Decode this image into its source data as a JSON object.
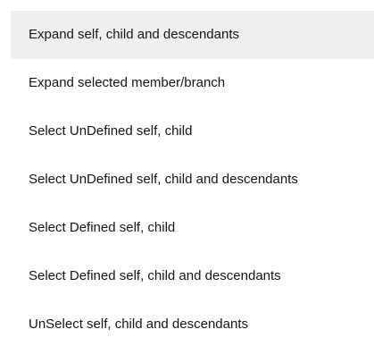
{
  "menu": {
    "hovered_index": 0,
    "items": [
      "Expand self, child and descendants",
      "Expand selected member/branch",
      "Select UnDefined self, child",
      "Select UnDefined self, child and descendants",
      "Select Defined self, child",
      "Select Defined self, child and descendants",
      "UnSelect self, child and descendants"
    ]
  },
  "colors": {
    "text": "#161513",
    "hover_background": "#f1efed",
    "background": "#ffffff"
  }
}
